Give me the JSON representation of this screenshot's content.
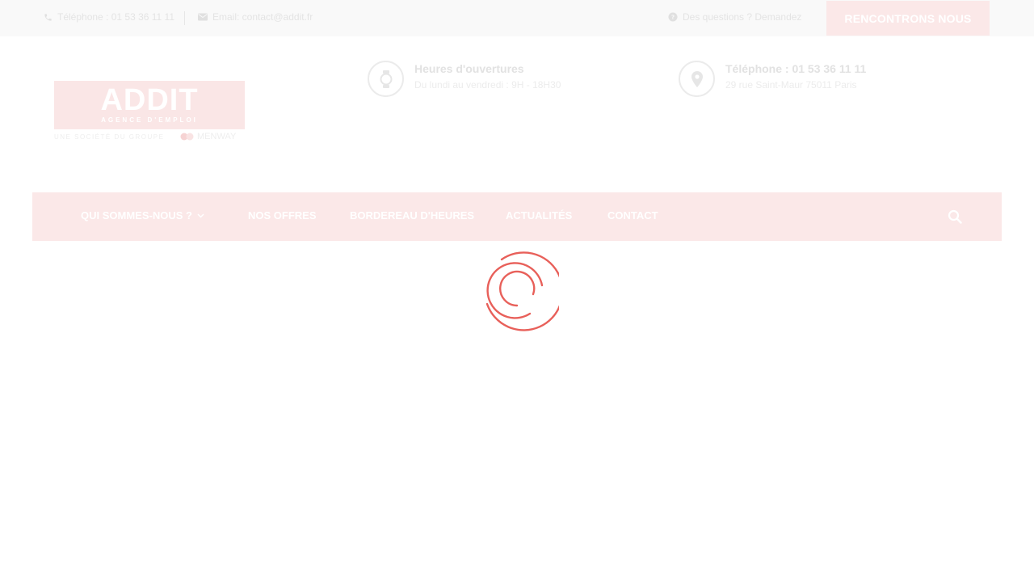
{
  "topbar": {
    "phone": "Téléphone : 01 53 36 11 11",
    "email": "Email: contact@addit.fr",
    "question": "Des questions ? Demandez",
    "cta_label": "RENCONTRONS NOUS"
  },
  "logo": {
    "title": "ADDIT",
    "subtitle": "AGENCE D'EMPLOI",
    "group": "UNE SOCIÉTÉ DU GROUPE",
    "group_brand": "MENWAY"
  },
  "info": {
    "hours_title": "Heures d'ouvertures",
    "hours_text": "Du lundi au vendredi : 9H - 18H30",
    "contact_title": "Téléphone : 01 53 36 11 11",
    "contact_text": "29 rue Saint-Maur 75011 Paris"
  },
  "nav": {
    "items": [
      {
        "label": "QUI SOMMES-NOUS ?"
      },
      {
        "label": "NOS OFFRES"
      },
      {
        "label": "BORDEREAU D'HEURES"
      },
      {
        "label": "ACTUALITÉS"
      },
      {
        "label": "CONTACT"
      }
    ]
  },
  "icons": {
    "phone": "phone-icon",
    "email": "envelope-icon",
    "question": "question-circle-icon",
    "hours": "watch-icon",
    "location": "map-pin-icon",
    "dropdown": "chevron-down-icon",
    "search": "search-icon",
    "loader": "loading-spinner-icon"
  },
  "colors": {
    "accent": "#e8605a",
    "brand_faded": "#fbe8e8"
  }
}
